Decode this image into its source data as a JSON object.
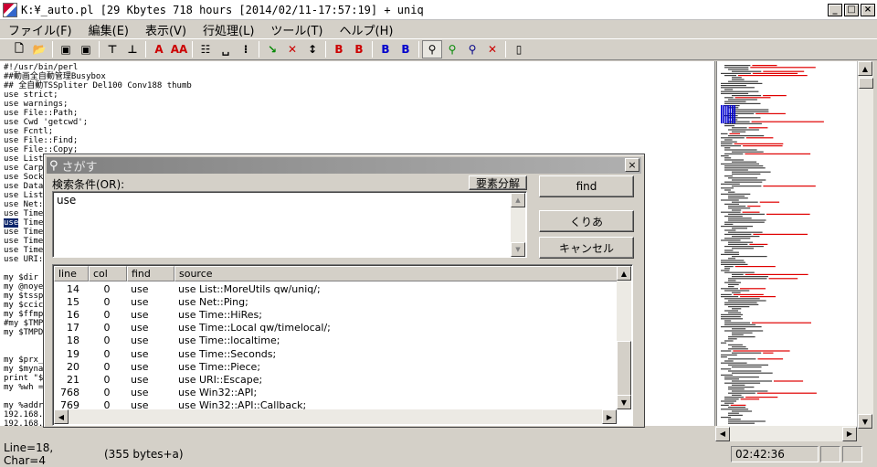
{
  "window": {
    "title": "K:¥_auto.pl [29 Kbytes 718 hours [2014/02/11-17:57:19] + uniq",
    "min": "_",
    "max": "□",
    "close": "×"
  },
  "menu": [
    "ファイル(F)",
    "編集(E)",
    "表示(V)",
    "行処理(L)",
    "ツール(T)",
    "ヘルプ(H)"
  ],
  "toolbar": {
    "icons": [
      "new-file-icon",
      "open-folder-icon",
      "save-icon",
      "save-as-icon",
      "go-top-icon",
      "go-bottom-icon",
      "font-a-icon",
      "font-aa-icon",
      "grid-icon",
      "space-icon",
      "dots-icon",
      "green-arrow-icon",
      "red-x-arrow-icon",
      "updown-icon",
      "bookmark-1-icon",
      "bookmark-2-icon",
      "bookmark-3-icon",
      "bookmark-4-icon",
      "search-icon",
      "search-next-icon",
      "search-prev-icon",
      "stop-search-icon",
      "doc-icon"
    ],
    "glyphs": [
      "🗋",
      "📂",
      "▣",
      "▣",
      "⊤",
      "⊥",
      "A",
      "AA",
      "☷",
      "␣",
      "⁝",
      "↘",
      "✕",
      "↕",
      "B",
      "B",
      "B",
      "B",
      "⚲",
      "⚲",
      "⚲",
      "✕",
      "▯"
    ]
  },
  "editor": {
    "lines": [
      "#!/usr/bin/perl",
      "##動画全自動管理Busybox",
      "## 全自動TSSpliter Del100 Conv188 thumb",
      "use strict;",
      "use warnings;",
      "use File::Path;",
      "use Cwd 'getcwd';",
      "use Fcntl;",
      "use File::Find;",
      "use File::Copy;",
      "use List",
      "use Carp",
      "use Sock",
      "use Data",
      "use List",
      "use Net:",
      "use Time",
      "use Time",
      "use Time",
      "use Time",
      "use Time",
      "use URI:",
      "",
      "my $dir",
      "my @noye",
      "my $tssp",
      "my $ccic",
      "my $ffmp",
      "#my $TMP",
      "my $TMPD",
      "",
      "",
      "my $prx_",
      "my $myna",
      "print \"$",
      "my %wh =",
      "",
      "my %addr",
      "192.168.",
      "192.168."
    ],
    "selected_line_index": 17,
    "selected_text": "use"
  },
  "status": {
    "position": "Line=18, Char=4",
    "bytes": "(355 bytes+a)",
    "time": "02:42:36"
  },
  "dialog": {
    "title": "さがす",
    "close": "×",
    "search_label": "検索条件(OR):",
    "parse_button": "要素分解",
    "query": "use",
    "find_button": "find",
    "clear_button": "くりあ",
    "cancel_button": "キャンセル",
    "columns": [
      "line",
      "col",
      "find",
      "source"
    ],
    "rows": [
      {
        "line": "14",
        "col": "0",
        "find": "use",
        "source": "use List::MoreUtils qw/uniq/;"
      },
      {
        "line": "15",
        "col": "0",
        "find": "use",
        "source": "use Net::Ping;"
      },
      {
        "line": "16",
        "col": "0",
        "find": "use",
        "source": "use Time::HiRes;"
      },
      {
        "line": "17",
        "col": "0",
        "find": "use",
        "source": "use Time::Local qw/timelocal/;"
      },
      {
        "line": "18",
        "col": "0",
        "find": "use",
        "source": "use Time::localtime;"
      },
      {
        "line": "19",
        "col": "0",
        "find": "use",
        "source": "use Time::Seconds;"
      },
      {
        "line": "20",
        "col": "0",
        "find": "use",
        "source": "use Time::Piece;"
      },
      {
        "line": "21",
        "col": "0",
        "find": "use",
        "source": "use URI::Escape;"
      },
      {
        "line": "768",
        "col": "0",
        "find": "use",
        "source": "use Win32::API;"
      },
      {
        "line": "769",
        "col": "0",
        "find": "use",
        "source": "use Win32::API::Callback;"
      }
    ]
  },
  "colors": {
    "selection": "#0a246a",
    "dialog_title": "#808080",
    "minimap_red": "#e00000",
    "minimap_blue": "#0000d0"
  }
}
